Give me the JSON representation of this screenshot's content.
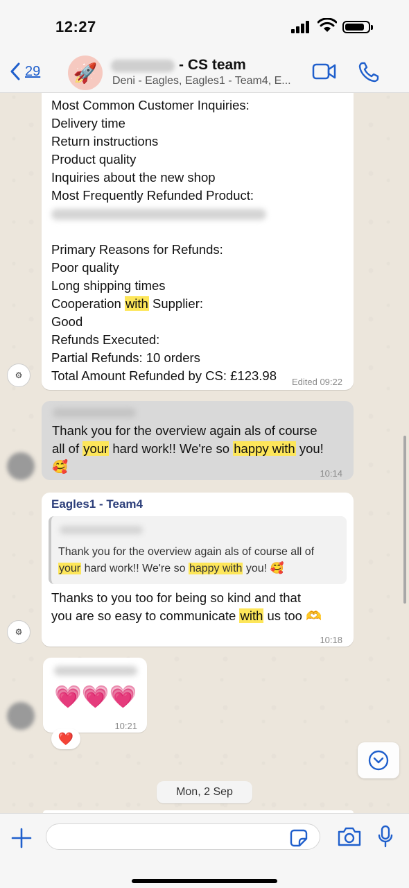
{
  "status_bar": {
    "time": "12:27",
    "battery_level": 0.85
  },
  "header": {
    "back_count": "29",
    "title": "- CS team",
    "subtitle": "Deni - Eagles, Eagles1 - Team4, E..."
  },
  "messages": {
    "overview": {
      "lines": [
        "Most Common Customer Inquiries:",
        "Delivery time",
        "Return instructions",
        "Product quality",
        "Inquiries about the new shop",
        "Most Frequently Refunded Product:",
        "",
        "Primary Reasons for Refunds:",
        "Poor quality",
        "Long shipping times"
      ],
      "coop_pre": "Cooperation ",
      "coop_hl": "with",
      "coop_post": " Supplier:",
      "lines_after": [
        "Good",
        "Refunds Executed:",
        "Partial Refunds: 10 orders",
        "Total Amount Refunded by CS: £123.98"
      ],
      "meta": "Edited 09:22"
    },
    "thanks": {
      "line1": "Thank you for the overview again als of course",
      "line2_a": "all of ",
      "line2_hl1": "your",
      "line2_b": " hard work!! We're so ",
      "line2_hl2": "happy with",
      "line2_c": " you!",
      "emoji": "🥰",
      "time": "10:14"
    },
    "reply": {
      "sender": "Eagles1 - Team4",
      "quote_line1": "Thank you for the overview again als of course all of",
      "quote_hl1": "your",
      "quote_b": " hard work!! We're so ",
      "quote_hl2": "happy with",
      "quote_c": " you! 🥰",
      "line1": "Thanks to you too for being so kind and that",
      "line2_a": "you are so easy to communicate ",
      "line2_hl": "with",
      "line2_b": " us too 🫶",
      "time": "10:18"
    },
    "hearts": {
      "emoji": "💗💗💗",
      "time": "10:21",
      "reaction": "❤️"
    }
  },
  "date_divider": "Mon, 2 Sep",
  "input": {
    "placeholder": ""
  },
  "icons": {
    "back": "chevron-left-icon",
    "video": "video-icon",
    "call": "phone-icon",
    "plus": "plus-icon",
    "sticker": "sticker-icon",
    "camera": "camera-icon",
    "mic": "microphone-icon",
    "scroll": "chevron-down-icon"
  },
  "colors": {
    "highlight": "#fde65a",
    "accent": "#1f5fcc",
    "incoming": "#ffffff",
    "grey_bubble": "#d9d9d9"
  }
}
